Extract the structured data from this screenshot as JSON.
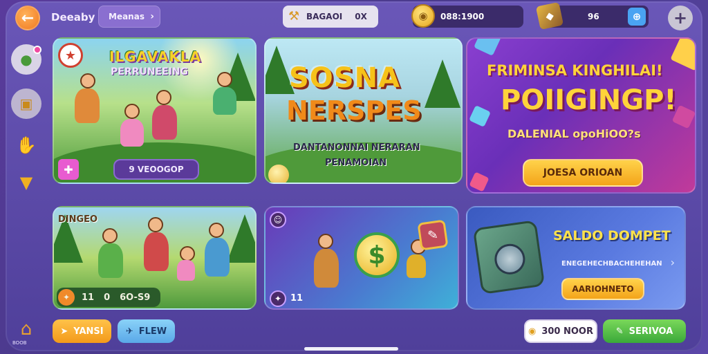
{
  "header": {
    "title": "Deeaby",
    "tag_label": "Meanas",
    "stat_label": "BAGAOI",
    "stat_value": "0X",
    "coins": "088:1900",
    "gems": "96"
  },
  "sidebar": {
    "label_bottom": "BOOB"
  },
  "cards": {
    "c1": {
      "title": "ILGAVAKLA",
      "subtitle": "PERRUNEEING",
      "button": "9 VEOOGOP"
    },
    "c2": {
      "title": "SOSNA",
      "title2": "NERSPES",
      "sub1": "DANTANONNAI NERARAN",
      "sub2": "PENAMOIAN"
    },
    "c3": {
      "title": "FRIMINSA KINGHILAI!",
      "title2": "POIIGINGP!",
      "subtitle": "DALENIAL opoHiOO?s",
      "button": "JOESA ORIOAN"
    },
    "c4": {
      "title": "DINGEO",
      "bar_a": "11",
      "bar_b": "0",
      "bar_c": "6O-S9"
    },
    "c5": {
      "badge": "11"
    },
    "c6": {
      "title": "SALDO DOMPET",
      "subtitle": "ENEGEHECHBACHEHEHAN",
      "button": "AARIOHNETO"
    }
  },
  "bottom": {
    "btn1": "YANSI",
    "btn2": "FLEW",
    "btn3": "300 NOOR",
    "btn4": "SERIVOA"
  },
  "icons": {
    "back": "arrow-left-icon",
    "plus": "plus-icon",
    "gem_add": "gem-add-icon"
  },
  "colors": {
    "accent_orange": "#f3a41a",
    "accent_green": "#3aa83a",
    "background": "#4f3f9a"
  }
}
